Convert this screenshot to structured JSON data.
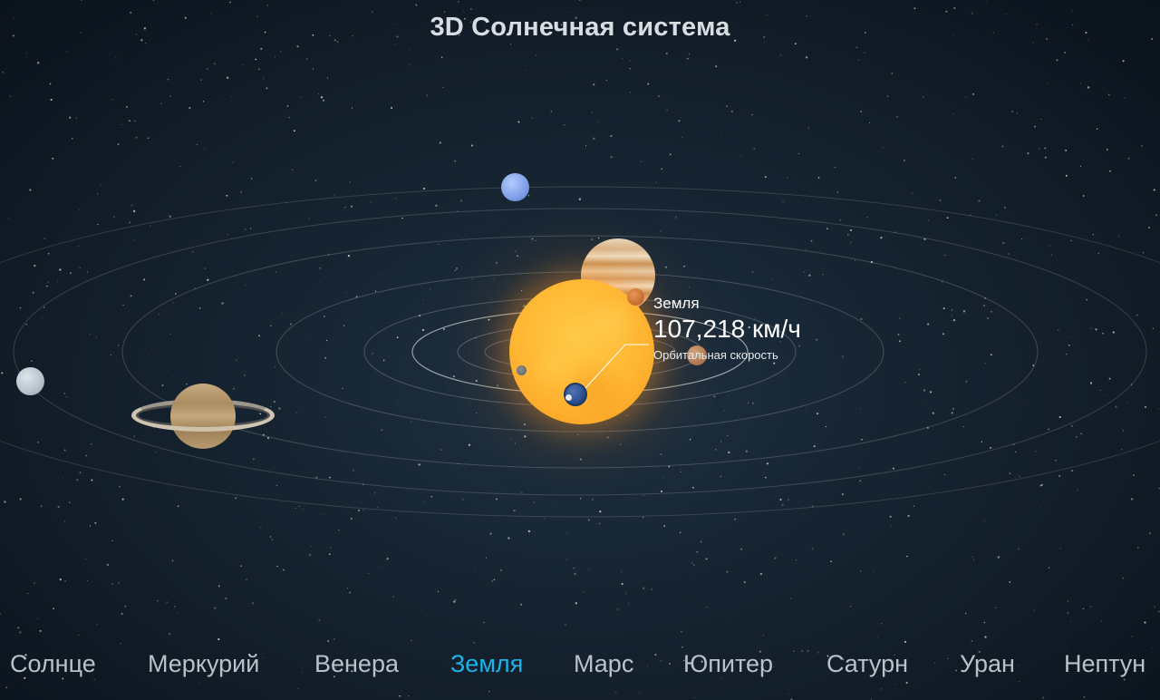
{
  "title": "3D Солнечная система",
  "selected_planet": {
    "name": "Земля",
    "speed": "107,218 км/ч",
    "caption": "Орбитальная скорость"
  },
  "nav": {
    "active": "Земля",
    "items": [
      {
        "id": "sun",
        "label": "Солнце"
      },
      {
        "id": "mercury",
        "label": "Меркурий"
      },
      {
        "id": "venus",
        "label": "Венера"
      },
      {
        "id": "earth",
        "label": "Земля"
      },
      {
        "id": "mars",
        "label": "Марс"
      },
      {
        "id": "jupiter",
        "label": "Юпитер"
      },
      {
        "id": "saturn",
        "label": "Сатурн"
      },
      {
        "id": "uranus",
        "label": "Уран"
      },
      {
        "id": "neptune",
        "label": "Нептун"
      }
    ]
  },
  "colors": {
    "accent": "#1ab3ea",
    "nav_text": "#b9c2ca",
    "title_text": "#d8dde2",
    "sun": "#ffb632",
    "background": "#15222f"
  }
}
